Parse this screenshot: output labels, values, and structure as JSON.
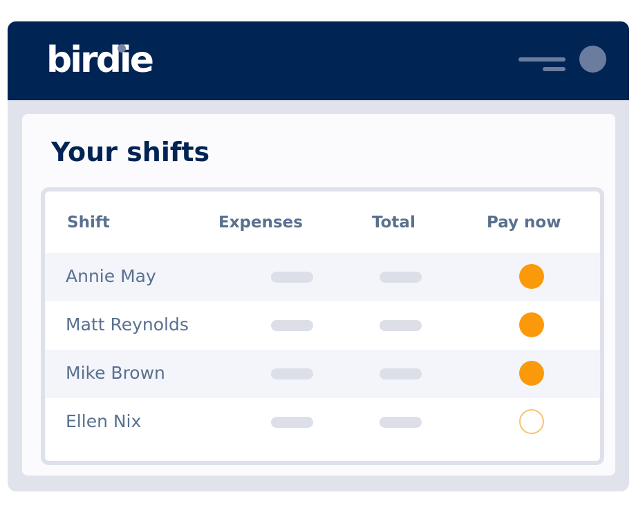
{
  "app": {
    "logo_text": "birdie"
  },
  "header": {
    "menu_icon": "hamburger-icon",
    "avatar_icon": "avatar-circle"
  },
  "main": {
    "title": "Your shifts",
    "table": {
      "columns": [
        "Shift",
        "Expenses",
        "Total",
        "Pay now"
      ],
      "rows": [
        {
          "name": "Annie May",
          "expenses": "",
          "total": "",
          "pay_now": true
        },
        {
          "name": "Matt Reynolds",
          "expenses": "",
          "total": "",
          "pay_now": true
        },
        {
          "name": "Mike Brown",
          "expenses": "",
          "total": "",
          "pay_now": true
        },
        {
          "name": "Ellen Nix",
          "expenses": "",
          "total": "",
          "pay_now": false
        }
      ]
    }
  },
  "colors": {
    "header_bg": "#002454",
    "accent_orange": "#fa9a0a",
    "text_muted": "#59708f",
    "placeholder_pill": "#dcdfe7"
  }
}
